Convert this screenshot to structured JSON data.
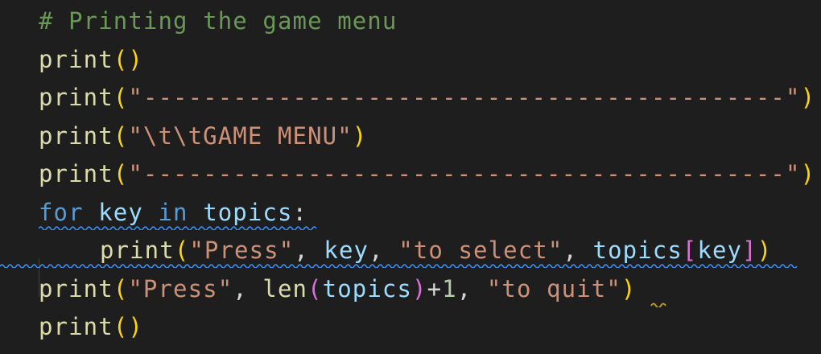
{
  "editor": {
    "lines": [
      {
        "tokens": [
          {
            "t": "# Printing the game menu",
            "c": "cm"
          }
        ]
      },
      {
        "tokens": [
          {
            "t": "print",
            "c": "fn"
          },
          {
            "t": "()",
            "c": "b1"
          }
        ]
      },
      {
        "tokens": [
          {
            "t": "print",
            "c": "fn"
          },
          {
            "t": "(",
            "c": "b1"
          },
          {
            "t": "\"-------------------------------------------\"",
            "c": "str"
          },
          {
            "t": ")",
            "c": "b1"
          }
        ]
      },
      {
        "tokens": [
          {
            "t": "print",
            "c": "fn"
          },
          {
            "t": "(",
            "c": "b1"
          },
          {
            "t": "\"\\t\\tGAME MENU\"",
            "c": "str"
          },
          {
            "t": ")",
            "c": "b1"
          }
        ]
      },
      {
        "tokens": [
          {
            "t": "print",
            "c": "fn"
          },
          {
            "t": "(",
            "c": "b1"
          },
          {
            "t": "\"-------------------------------------------\"",
            "c": "str"
          },
          {
            "t": ")",
            "c": "b1"
          }
        ]
      },
      {
        "tokens": [
          {
            "t": "for",
            "c": "kw"
          },
          {
            "t": " ",
            "c": "plain"
          },
          {
            "t": "key",
            "c": "var"
          },
          {
            "t": " ",
            "c": "plain"
          },
          {
            "t": "in",
            "c": "kw"
          },
          {
            "t": " ",
            "c": "plain"
          },
          {
            "t": "topics",
            "c": "var"
          },
          {
            "t": ":",
            "c": "plain"
          }
        ]
      },
      {
        "indent": true,
        "tokens": [
          {
            "t": "print",
            "c": "fn"
          },
          {
            "t": "(",
            "c": "b1"
          },
          {
            "t": "\"Press\"",
            "c": "str"
          },
          {
            "t": ", ",
            "c": "plain"
          },
          {
            "t": "key",
            "c": "var"
          },
          {
            "t": ", ",
            "c": "plain"
          },
          {
            "t": "\"to select\"",
            "c": "str"
          },
          {
            "t": ", ",
            "c": "plain"
          },
          {
            "t": "topics",
            "c": "var"
          },
          {
            "t": "[",
            "c": "b2"
          },
          {
            "t": "key",
            "c": "var"
          },
          {
            "t": "]",
            "c": "b2"
          },
          {
            "t": ")",
            "c": "b1"
          }
        ]
      },
      {
        "tokens": [
          {
            "t": "print",
            "c": "fn"
          },
          {
            "t": "(",
            "c": "b1"
          },
          {
            "t": "\"Press\"",
            "c": "str"
          },
          {
            "t": ", ",
            "c": "plain"
          },
          {
            "t": "len",
            "c": "fn"
          },
          {
            "t": "(",
            "c": "b2"
          },
          {
            "t": "topics",
            "c": "var"
          },
          {
            "t": ")",
            "c": "b2"
          },
          {
            "t": "+",
            "c": "op"
          },
          {
            "t": "1",
            "c": "num"
          },
          {
            "t": ", ",
            "c": "plain"
          },
          {
            "t": "\"to quit\"",
            "c": "str"
          },
          {
            "t": ")",
            "c": "b1"
          }
        ]
      },
      {
        "tokens": [
          {
            "t": "print",
            "c": "fn"
          },
          {
            "t": "()",
            "c": "b1"
          }
        ]
      }
    ]
  },
  "colors": {
    "background": "#1e1e1e",
    "comment": "#6a9955",
    "function": "#dcdcaa",
    "keyword": "#569cd6",
    "variable": "#9cdcfe",
    "string": "#ce9178",
    "number": "#b5cea8",
    "bracket_level1": "#ffd700",
    "bracket_level2": "#da70d6",
    "info_squiggle": "#3794ff",
    "warning_squiggle": "#cca700"
  }
}
